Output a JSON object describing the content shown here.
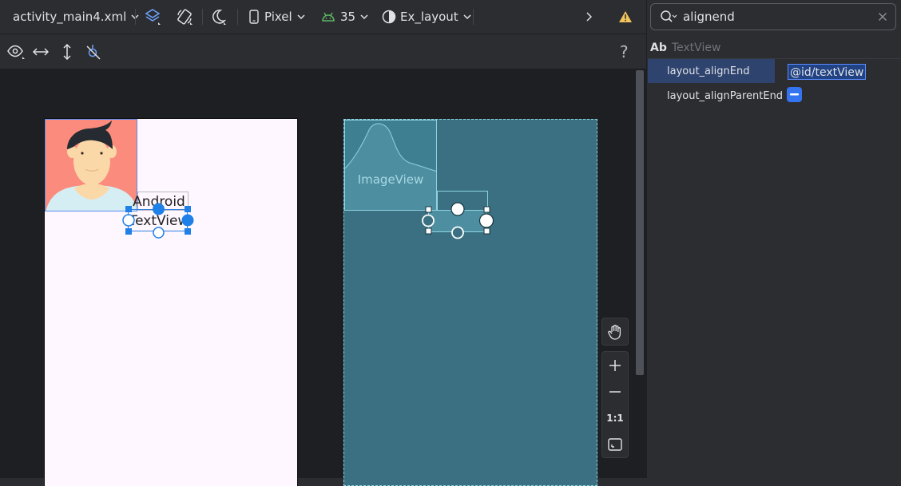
{
  "toolbar": {
    "file_name": "activity_main4.xml",
    "device": "Pixel",
    "api_level": "35",
    "theme": "Ex_layout"
  },
  "design": {
    "textview_text": "Android\nTextView"
  },
  "blueprint": {
    "image_label": "ImageView"
  },
  "zoom": {
    "one_to_one": "1:1"
  },
  "attributes": {
    "search": {
      "value": "alignend"
    },
    "component": {
      "badge": "Ab",
      "name": "TextView"
    },
    "rows": [
      {
        "name": "layout_alignEnd",
        "value": "@id/textView"
      },
      {
        "name": "layout_alignParentEnd"
      }
    ]
  },
  "colors": {
    "accent": "#3574f0",
    "warning": "#f2c55c",
    "api_icon": "#5fb865",
    "avatar_bg": "#fa8b7d",
    "blueprint_bg": "#3a7081",
    "design_bg": "#fef7ff"
  },
  "icons": {
    "design_mode": "layers-icon",
    "orientation": "rotate-icon",
    "night_mode": "moon-icon",
    "device": "phone-icon",
    "api": "android-icon",
    "theme": "contrast-icon",
    "overflow": "chevron-right-icon",
    "warning": "warning-icon",
    "visibility": "eye-icon",
    "help": "question-icon",
    "pan": "hand-icon",
    "zoom_in": "plus-icon",
    "zoom_out": "minus-icon",
    "fit": "fit-screen-icon"
  }
}
